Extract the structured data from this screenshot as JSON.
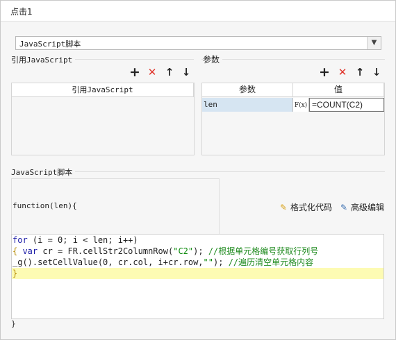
{
  "window": {
    "title": "点击1"
  },
  "combo": {
    "value": "JavaScript脚本"
  },
  "ref_section": {
    "label": "引用JavaScript",
    "column_header": "引用JavaScript"
  },
  "params_section": {
    "label": "参数",
    "columns": [
      "参数",
      "值"
    ],
    "rows": [
      {
        "name": "len",
        "fx": "F(x)",
        "value": "=COUNT(C2)"
      }
    ]
  },
  "script_section": {
    "label": "JavaScript脚本",
    "function_header": "function(len){",
    "format_label": "格式化代码",
    "advanced_label": "高级编辑",
    "close": "}",
    "code": {
      "l1": {
        "kw": "for",
        "rest": " (i = 0; i < len; i++)"
      },
      "l2": {
        "brace": "{",
        "kw": " var",
        "pre": " cr = FR.cellStr2ColumnRow(",
        "str": "\"C2\"",
        "post": "); ",
        "comment": "//根据单元格编号获取行列号"
      },
      "l3": {
        "pre": "_g().setCellValue(0, cr.col, i+cr.row,",
        "str": "\"\"",
        "post": "); ",
        "comment": "//遍历清空单元格内容"
      },
      "l4": {
        "brace": "}"
      }
    }
  },
  "icons": {
    "add": "plus-icon",
    "delete": "x-icon",
    "up": "arrow-up-icon",
    "down": "arrow-down-icon",
    "format": "broom-icon",
    "advanced": "edit-icon"
  },
  "colors": {
    "delete": "#e0362c",
    "param_row": "#d6e5f2",
    "highlight_line": "#fdfbb3",
    "keyword": "#1a1aa6",
    "comment": "#1e8a1e"
  }
}
